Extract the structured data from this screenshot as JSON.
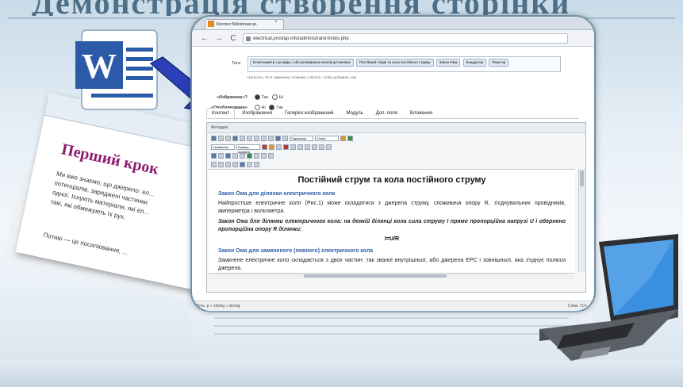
{
  "slide": {
    "title_ghost": "Демонстрація створення сторінки"
  },
  "word_doc": {
    "heading": "Перший крок",
    "lines": [
      "Ми вже знаємо, що джерело: ел...",
      "потенціалів, заряджені частинки",
      "одної. Існують матеріали, які ел...",
      "такі, які обмежують їх рух."
    ],
    "footer_line": "Потиві — це посилювання, ..."
  },
  "browser": {
    "tab_title": "Контент Бібліотеки зн.",
    "tab_close": "×",
    "back": "←",
    "forward": "→",
    "reload": "C",
    "url": "electrical.prosfap.info/administrator/index.php",
    "tags_label": "Теги",
    "tags": [
      "Електрометр з розміру і обслуговування електроустановок",
      "Постійний струм та кола постійного струму",
      "Закон Ома",
      "Кондуктор",
      "Реактор"
    ],
    "tags_hint": "Натисніть тег в заміннику словника і обітите, чтобы добавить нов",
    "featured": {
      "label": "«Избранное»?",
      "yes": "Так",
      "no": "Ні"
    },
    "published": {
      "label": "«Опубликовано»",
      "yes": "Так",
      "no": "Ні"
    },
    "content_tabs": [
      "Контент",
      "Изображения",
      "Галерея изображений",
      "Модуль",
      "Доп. поля",
      "Вложения"
    ],
    "editor_caption": "Метадані",
    "toolbar_selects": [
      "Параграф",
      "Стили",
      "Семейство",
      "Размер шрифта"
    ],
    "content_title": "Постійний струм та кола постійного струму",
    "sections": [
      {
        "heading": "Закон Ома для ділянки електричного кола",
        "paragraph": "Найпростіше електричне коло (Рис.1) може складатися з джерела струму, споживача опору R, з'єднувальних провідників, амперметра і вольтметра.",
        "law": "Закон Ома для ділянки електричного кола: на деякій ділянці кола сила струму І прямо пропорційна напрузі U і обернено пропорційна опору R ділянки:",
        "formula": "I=U/R"
      },
      {
        "heading": "Закон Ома для замкненого (повного) електричного кола",
        "paragraph": "Замкнене електричне коло складається з двох частин: так званої внутрішньої, або джерела ЕРС і зовнішньої, яка з'єднує полюси джерела."
      }
    ],
    "status_path": "Путь: p » strong » strong",
    "status_count": "Слов: 714"
  },
  "colors": {
    "accent_blue": "#2e5fa8",
    "word_heading": "#8b1c6f",
    "arrow": "#2a3fb8",
    "background": "#e7eff6"
  },
  "icons": [
    "word-logo-icon",
    "arrow-icon",
    "laptop-icon",
    "lock-icon",
    "favicon-icon"
  ]
}
